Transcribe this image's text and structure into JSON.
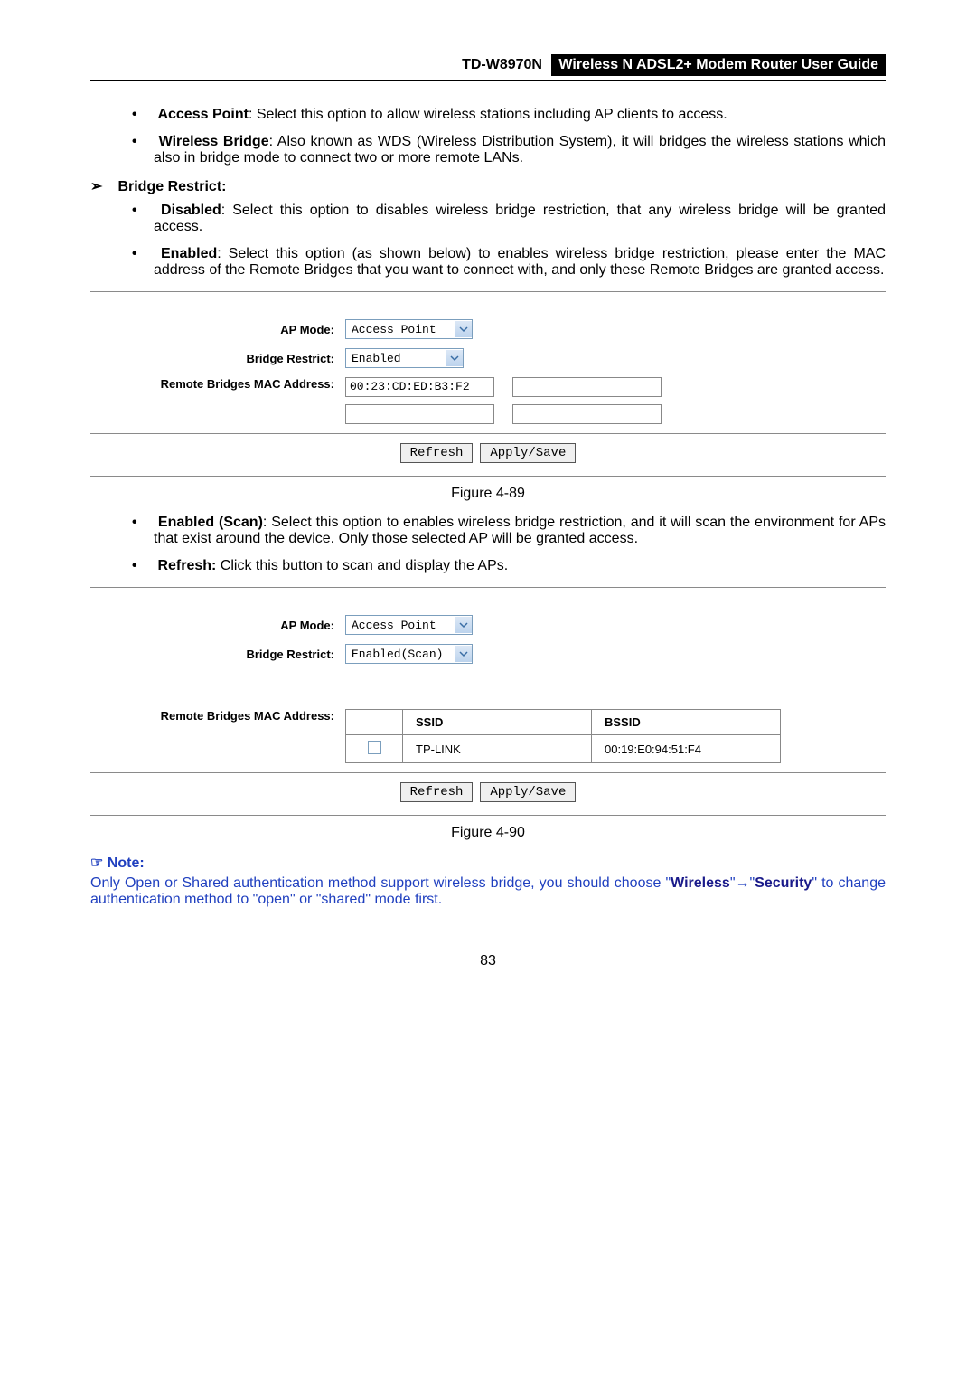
{
  "header": {
    "model": "TD-W8970N",
    "title": "Wireless N ADSL2+ Modem Router User Guide"
  },
  "bullets_top": {
    "ap_label": "Access Point",
    "ap_text": ": Select this option to allow wireless stations including AP clients to access.",
    "wb_label": "Wireless Bridge",
    "wb_text": ": Also known as WDS (Wireless Distribution System), it will bridges the wireless stations which also in bridge mode to connect two or more remote LANs."
  },
  "bridge_restrict_heading": "Bridge Restrict:",
  "bullets_br": {
    "dis_label": "Disabled",
    "dis_text": ": Select this option to disables wireless bridge restriction, that any wireless bridge will be granted access.",
    "en_label": "Enabled",
    "en_text": ": Select this option (as shown below) to enables wireless bridge restriction, please enter the MAC address of the Remote Bridges that you want to connect with, and only these Remote Bridges are granted access."
  },
  "fig1": {
    "ap_mode_label": "AP Mode:",
    "ap_mode_value": "Access Point",
    "br_label": "Bridge Restrict:",
    "br_value": "Enabled",
    "mac_label": "Remote Bridges MAC Address:",
    "mac1": "00:23:CD:ED:B3:F2",
    "refresh": "Refresh",
    "apply": "Apply/Save",
    "caption": "Figure 4-89"
  },
  "bullets_mid": {
    "scan_label": "Enabled (Scan)",
    "scan_text": ": Select this option to enables wireless bridge restriction, and it will scan the environment for APs that exist around the device. Only those selected AP will be granted access.",
    "refresh_label": "Refresh:",
    "refresh_text": " Click this button to scan and display the APs."
  },
  "fig2": {
    "ap_mode_label": "AP Mode:",
    "ap_mode_value": "Access Point",
    "br_label": "Bridge Restrict:",
    "br_value": "Enabled(Scan)",
    "mac_label": "Remote Bridges MAC Address:",
    "table": {
      "h_ssid": "SSID",
      "h_bssid": "BSSID",
      "row1_ssid": "TP-LINK",
      "row1_bssid": "00:19:E0:94:51:F4"
    },
    "refresh": "Refresh",
    "apply": "Apply/Save",
    "caption": "Figure 4-90"
  },
  "note": {
    "heading": "Note:",
    "body_pre": "Only Open or Shared authentication method support wireless bridge, you should choose \"",
    "body_b1": "Wireless",
    "body_mid1": "\"",
    "body_arrow": "→",
    "body_mid2": "\"",
    "body_b2": "Security",
    "body_post": "\" to change authentication method to \"open\" or \"shared\" mode first."
  },
  "page_number": "83"
}
